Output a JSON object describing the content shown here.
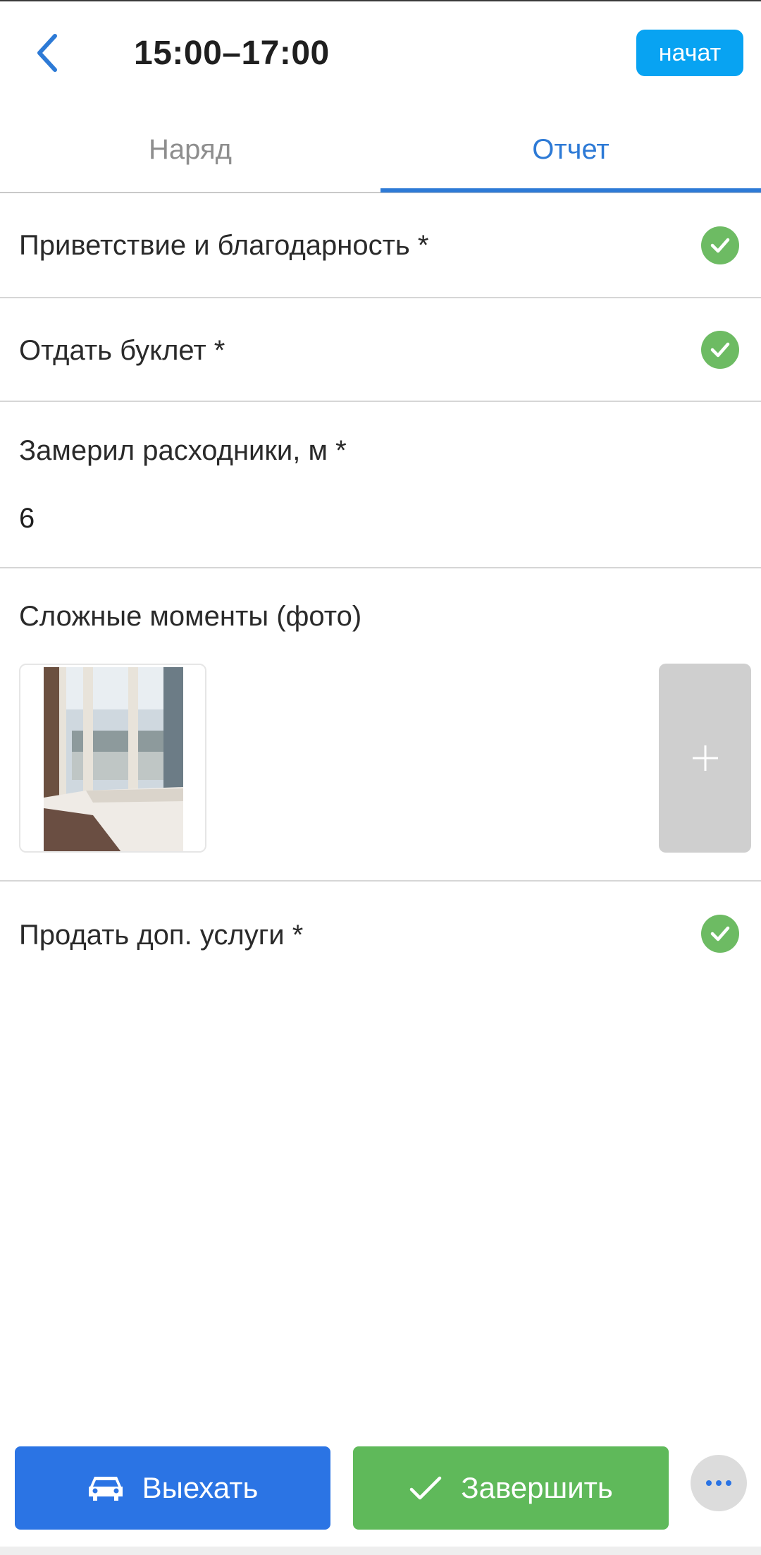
{
  "header": {
    "title": "15:00–17:00",
    "start_label": "начат",
    "back_icon": "chevron-left-icon",
    "accent_color": "#08a3f2"
  },
  "tabs": [
    {
      "label": "Наряд",
      "active": false
    },
    {
      "label": "Отчет",
      "active": true
    }
  ],
  "report": {
    "items": [
      {
        "label": "Приветствие и благодарность *",
        "checked": true
      },
      {
        "label": "Отдать буклет *",
        "checked": true
      },
      {
        "label": "Замерил расходники, м *",
        "value": "6"
      },
      {
        "label": "Сложные моменты (фото)",
        "photos": 1
      },
      {
        "label": "Продать доп. услуги *",
        "checked": true
      }
    ]
  },
  "actions": {
    "leave_label": "Выехать",
    "finish_label": "Завершить",
    "leave_color": "#2b74e4",
    "finish_color": "#5fb95a"
  }
}
